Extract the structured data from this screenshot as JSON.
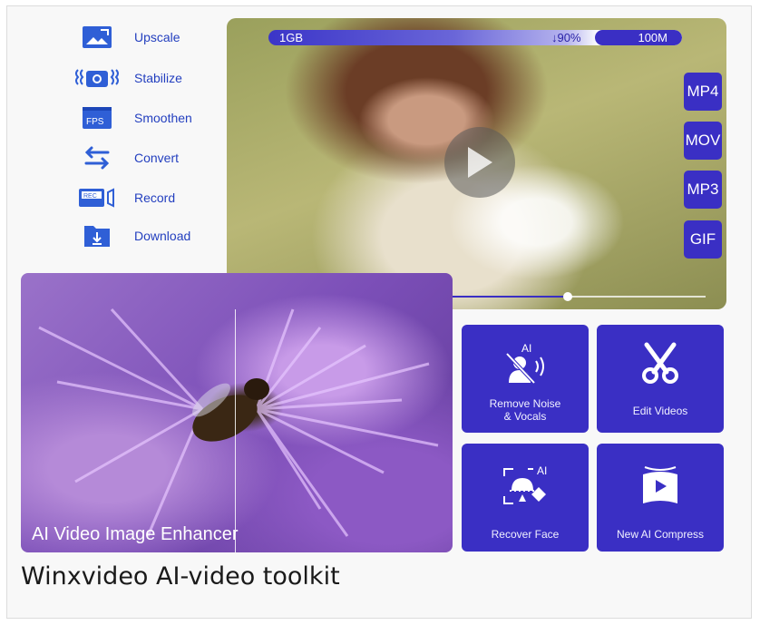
{
  "features": [
    {
      "label": "Upscale",
      "icon": "upscale-icon"
    },
    {
      "label": "Stabilize",
      "icon": "stabilize-icon"
    },
    {
      "label": "Smoothen",
      "icon": "fps-icon"
    },
    {
      "label": "Convert",
      "icon": "convert-icon"
    },
    {
      "label": "Record",
      "icon": "record-icon"
    },
    {
      "label": "Download",
      "icon": "download-icon"
    }
  ],
  "fps_badge": "FPS",
  "rec_badge": "REC",
  "size_bar": {
    "from": "1GB",
    "reduction": "↓90%",
    "to": "100M"
  },
  "formats": [
    "MP4",
    "MOV",
    "MP3",
    "GIF"
  ],
  "progress": 0.7,
  "enhancer_title": "AI Video Image Enhancer",
  "ai_badge": "AI",
  "tools": [
    {
      "label_line1": "Remove Noise",
      "label_line2": "& Vocals",
      "icon": "remove-noise-icon"
    },
    {
      "label_line1": "Edit Videos",
      "label_line2": "",
      "icon": "scissors-icon"
    },
    {
      "label_line1": "Recover Face",
      "label_line2": "",
      "icon": "recover-face-icon"
    },
    {
      "label_line1": "New AI Compress",
      "label_line2": "",
      "icon": "compress-icon"
    }
  ],
  "caption": "Winxvideo AI-video toolkit",
  "colors": {
    "brand": "#3a2fc4",
    "link": "#233fbf"
  }
}
